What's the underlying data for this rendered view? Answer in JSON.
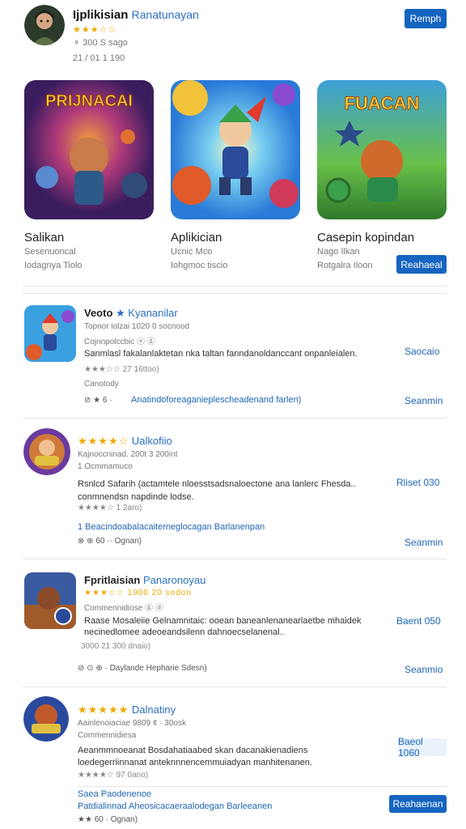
{
  "header": {
    "title": "Ijplikisian",
    "subtitle": "Ranatunayan",
    "rating_text": "★★★☆☆",
    "meta": "⚬ 300  S sago",
    "date": "21 / 01 1 190",
    "button": "Remph"
  },
  "featured": [
    {
      "banner": "PRIJNACAI",
      "title": "Salikan",
      "sub": "Sesenuoncal",
      "meta": "Iodagnya Tiolo"
    },
    {
      "banner": "",
      "title": "Aplikician",
      "sub": "Ucnic Mco",
      "meta": "Iohgmoc tiscio"
    },
    {
      "banner": "FUACAN",
      "title": "Casepin kopindan",
      "sub": "Nago Ilkan",
      "meta": "Rotgalra Iloon",
      "button": "Reahaeal"
    }
  ],
  "list": [
    {
      "name": "Veoto",
      "name_suffix": "★ Kyananilar",
      "line1": "Topnor iolzai  1020  0 socnood",
      "line2": "Cojnnpolccbic  ⓧ ⓖ",
      "desc": "Sanmlasl fakalanlaktetan nka taltan fanndanoldanccant onpanleialen.",
      "rating": "★★★☆☆ 27  16ttoo)",
      "extra": "Canotody",
      "link": "Anatindoforeaganieplescheadenand  farlen)",
      "icons": "⊘ ★ 6 ·",
      "side": "Saocaio",
      "action": "Seanmin"
    },
    {
      "name": "",
      "name_suffix": "Ualkofiio",
      "stars_title": "★★★★☆",
      "line1": "Kajnoccninad.  200t  3 200int",
      "line2": "1 Ocmmamuco",
      "desc": "Rsnlcd Safarih (actamtele nloesstsadsnaloectone ana lanlerc Fhesda.. conmnendsn napdinde lodse.",
      "rating": "★★★★☆ 1 2aro)",
      "extra": "",
      "link": "1 Beacindoabalacaiterneglocagan Barlanenpan",
      "icons": "⊗ ⊕ 60 ·· Ognan)",
      "side": "Rliset 030",
      "action": "Seanmin"
    },
    {
      "name": "Fpritlaisian",
      "name_suffix": "Panaronoyau",
      "line1": "★★★☆☆  1900  20 sodon",
      "line2": "Commennidiose  ⓖ ⓓ",
      "desc": "Raase Mosaleiie Gelnamnitaic: ooean baneanlenanearlaetbe mhaidek necinedlomee adeoeandsilenn dahnoecselanenal..",
      "rating": "3000  21 300 dnaio)",
      "extra": "",
      "link": "",
      "icons": "⊘ ⊙ ⊕ · Daylande Hepharie  Sdesn)",
      "side": "Baent 050",
      "action": "Seanmio"
    },
    {
      "name": "",
      "name_suffix": "Dalnatiny",
      "stars_title": "★★★★★",
      "line1": "Aainlenoiaciae  9809 ¢ · 30osk",
      "line2": "Commennidiesa",
      "desc": "Aeanmmnoeanat  Bosdahatiaabed skan dacanakienadiens loedegerriinnanat anteknnnencemmuiadyan manhitenanen.",
      "rating": "★★★★☆ 97  0ano)",
      "extra": "Saea Paodenenoe",
      "link": "Patdialinnad Aheosicacaeraalodegan Barleeanen",
      "icons": "★★ 60 · Ognan)",
      "side": "Baeol 1060",
      "action": "Reahaenan"
    }
  ]
}
